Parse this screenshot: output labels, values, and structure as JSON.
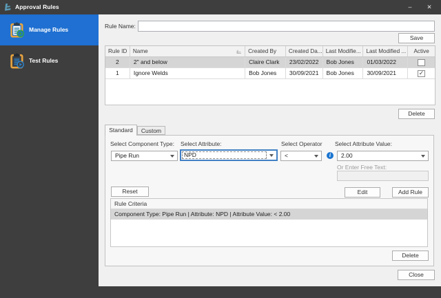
{
  "window": {
    "title": "Approval Rules",
    "minimize_glyph": "–",
    "close_glyph": "✕"
  },
  "sidebar": {
    "items": [
      {
        "label": "Manage Rules",
        "icon": "clipboard-add-icon",
        "selected": true
      },
      {
        "label": "Test Rules",
        "icon": "clipboard-play-icon",
        "selected": false
      }
    ]
  },
  "form": {
    "rule_name_label": "Rule Name:",
    "rule_name_value": "",
    "save_label": "Save",
    "delete_rules_label": "Delete",
    "close_label": "Close"
  },
  "rules_table": {
    "columns": [
      "Rule ID",
      "Name",
      "Created By",
      "Created Da...",
      "Last Modifie...",
      "Last Modified ...",
      "Active"
    ],
    "rows": [
      {
        "rule_id": "2",
        "name": "2\" and below",
        "created_by": "Claire Clark",
        "created_date": "23/02/2022",
        "last_modified_by": "Bob Jones",
        "last_modified_date": "01/03/2022",
        "active": false,
        "selected": true
      },
      {
        "rule_id": "1",
        "name": "Ignore Welds",
        "created_by": "Bob Jones",
        "created_date": "30/09/2021",
        "last_modified_by": "Bob Jones",
        "last_modified_date": "30/09/2021",
        "active": true,
        "selected": false
      }
    ]
  },
  "tabs": [
    {
      "label": "Standard",
      "selected": true
    },
    {
      "label": "Custom",
      "selected": false
    }
  ],
  "standard_tab": {
    "component_type_label": "Select Component Type:",
    "component_type_value": "Pipe Run",
    "attribute_label": "Select Attribute:",
    "attribute_value": "NPD",
    "operator_label": "Select Operator",
    "operator_value": "<",
    "attribute_value_label": "Select Attribute Value:",
    "attribute_value_value": "2.00",
    "info_icon_glyph": "i",
    "free_text_label": "Or Enter Free Text:",
    "free_text_value": "",
    "reset_label": "Reset",
    "edit_label": "Edit",
    "add_rule_label": "Add Rule",
    "criteria": {
      "header": "Rule Criteria",
      "items": [
        {
          "text": "Component Type: Pipe Run | Attribute: NPD | Attribute Value: < 2.00",
          "selected": true
        }
      ],
      "delete_label": "Delete"
    }
  },
  "colors": {
    "titlebar": "#3E3E3E",
    "sidebar": "#3E3E3E",
    "sidebar_selected": "#1F70D2",
    "main_background": "#F0F0F0",
    "selected_row": "#D5D5D5",
    "focus_border": "#4180C4",
    "info_icon": "#1B75D1"
  }
}
